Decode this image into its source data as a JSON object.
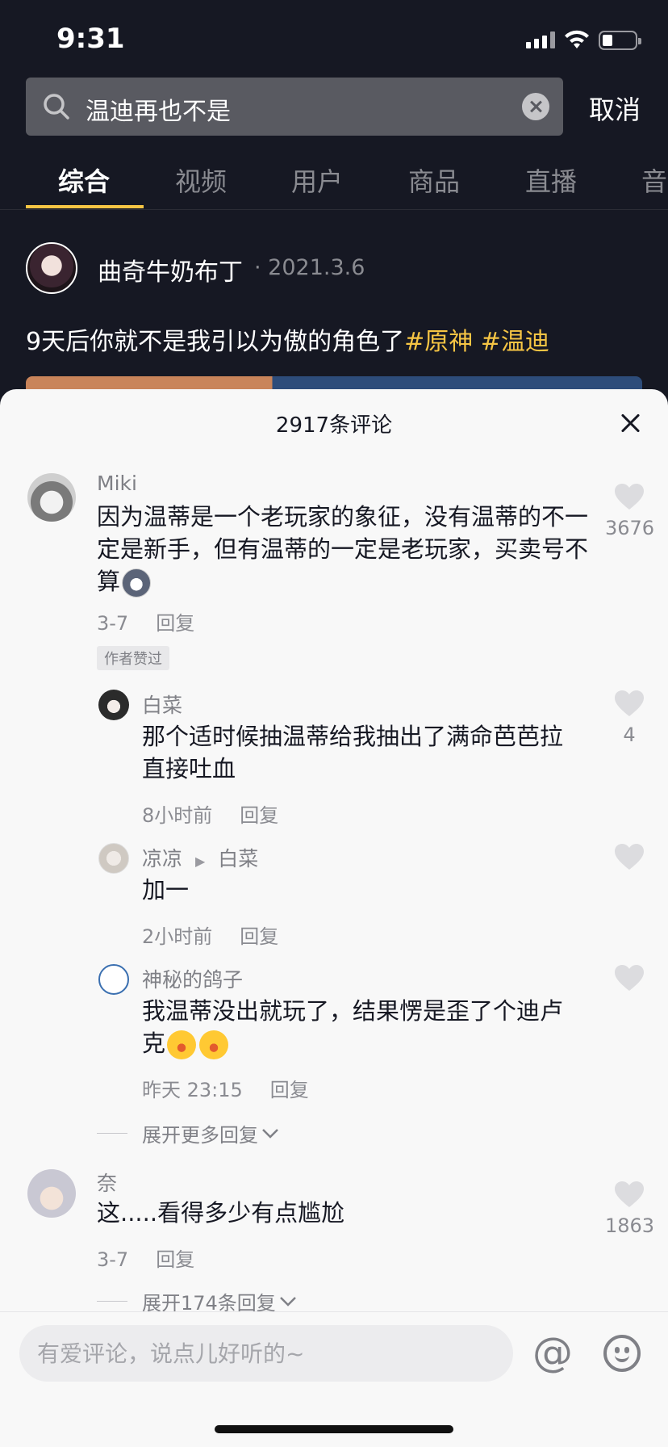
{
  "status": {
    "time": "9:31"
  },
  "search": {
    "query": "温迪再也不是",
    "cancel": "取消"
  },
  "tabs": [
    "综合",
    "视频",
    "用户",
    "商品",
    "直播",
    "音"
  ],
  "post": {
    "author": "曲奇牛奶布丁",
    "date": "· 2021.3.6",
    "text": "9天后你就不是我引以为傲的角色了",
    "tags": [
      "#原神",
      "#温迪"
    ]
  },
  "comments_sheet": {
    "title": "2917条评论",
    "comments": [
      {
        "user": "Miki",
        "text": "因为温蒂是一个老玩家的象征，没有温蒂的不一定是新手，但有温蒂的一定是老玩家，买卖号不算",
        "time": "3-7",
        "reply": "回复",
        "badge": "作者赞过",
        "likes": "3676",
        "replies": [
          {
            "user": "白菜",
            "text": "那个适时候抽温蒂给我抽出了满命芭芭拉直接吐血",
            "time": "8小时前",
            "reply": "回复",
            "likes": "4"
          },
          {
            "user": "凉凉",
            "reply_to": "白菜",
            "text": "加一",
            "time": "2小时前",
            "reply": "回复",
            "likes": ""
          },
          {
            "user": "神秘的鸽子",
            "text": "我温蒂没出就玩了，结果愣是歪了个迪卢克",
            "time": "昨天 23:15",
            "reply": "回复",
            "likes": ""
          }
        ],
        "expand": "展开更多回复"
      },
      {
        "user": "奈",
        "text": "这.....看得多少有点尴尬",
        "time": "3-7",
        "reply": "回复",
        "likes": "1863",
        "expand": "展开174条回复"
      }
    ]
  },
  "bottom": {
    "placeholder": "有爱评论，说点儿好听的~",
    "at": "@"
  }
}
